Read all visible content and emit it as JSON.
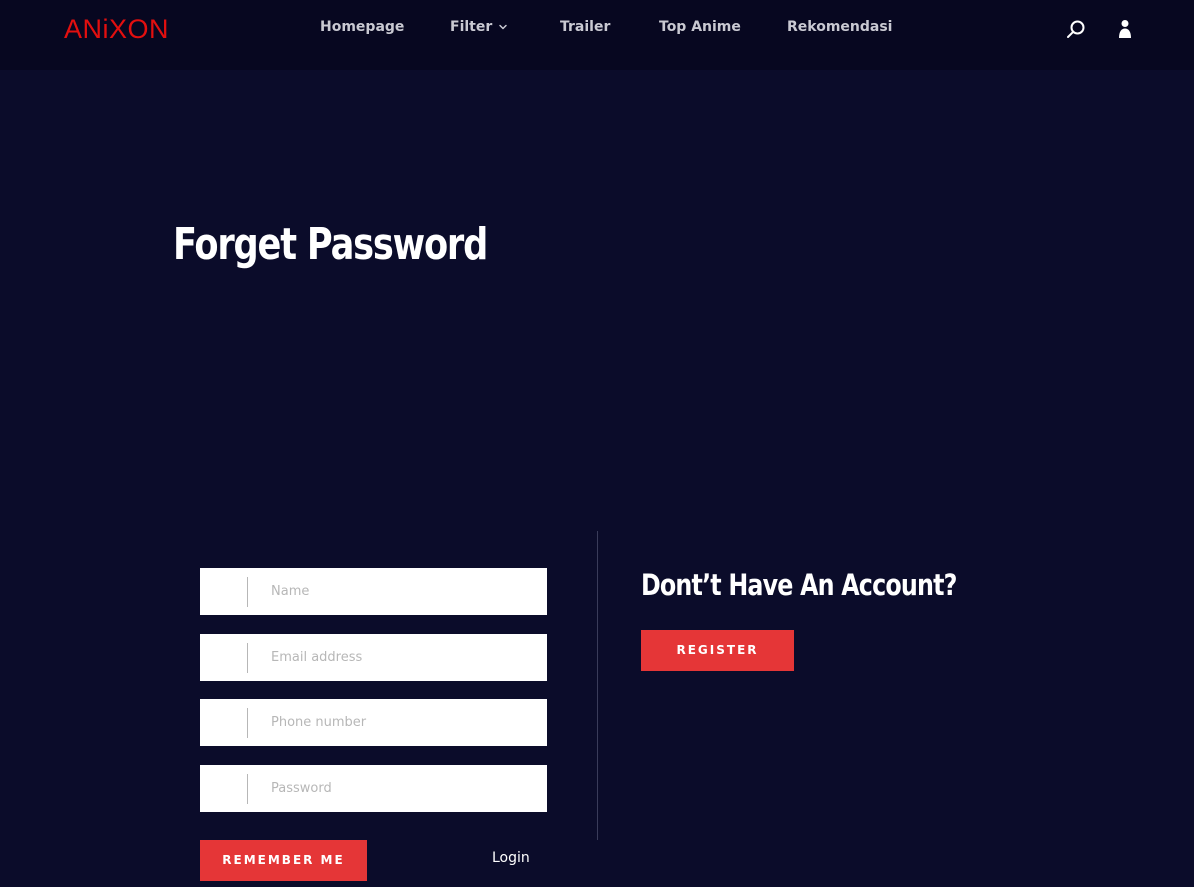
{
  "header": {
    "logo_text": "ANiXON",
    "nav": {
      "homepage": "Homepage",
      "filter": "Filter",
      "trailer": "Trailer",
      "top_anime": "Top Anime",
      "rekomendasi": "Rekomendasi"
    },
    "icons": {
      "search": "search-icon",
      "user": "user-icon",
      "filter_dropdown": "chevron-down-icon"
    }
  },
  "main": {
    "title": "Forget Password"
  },
  "form": {
    "name_placeholder": "Name",
    "email_placeholder": "Email address",
    "phone_placeholder": "Phone number",
    "password_placeholder": "Password",
    "remember_label": "REMEMBER ME",
    "login_link": "Login"
  },
  "side": {
    "title": "Dont’t Have An Account?",
    "register_label": "REGISTER"
  },
  "colors": {
    "background": "#0b0c2a",
    "header_background": "#070720",
    "accent_red": "#e53637",
    "logo_red": "#e20f0f"
  }
}
